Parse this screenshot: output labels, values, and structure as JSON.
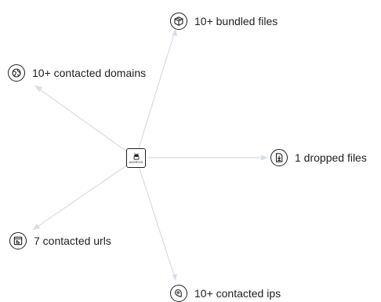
{
  "center": {
    "icon": "android-icon",
    "caption": "ANDROID"
  },
  "nodes": {
    "bundled_files": {
      "icon": "package-icon",
      "label": "10+ bundled files"
    },
    "contacted_domains": {
      "icon": "domain-icon",
      "label": "10+ contacted domains"
    },
    "dropped_files": {
      "icon": "download-file-icon",
      "label": "1 dropped files"
    },
    "contacted_urls": {
      "icon": "url-icon",
      "label": "7 contacted urls"
    },
    "contacted_ips": {
      "icon": "ip-location-icon",
      "label": "10+ contacted ips"
    }
  },
  "colors": {
    "edge": "#d6dde6",
    "icon_stroke": "#1f1f1f",
    "text": "#1f1f1f"
  }
}
